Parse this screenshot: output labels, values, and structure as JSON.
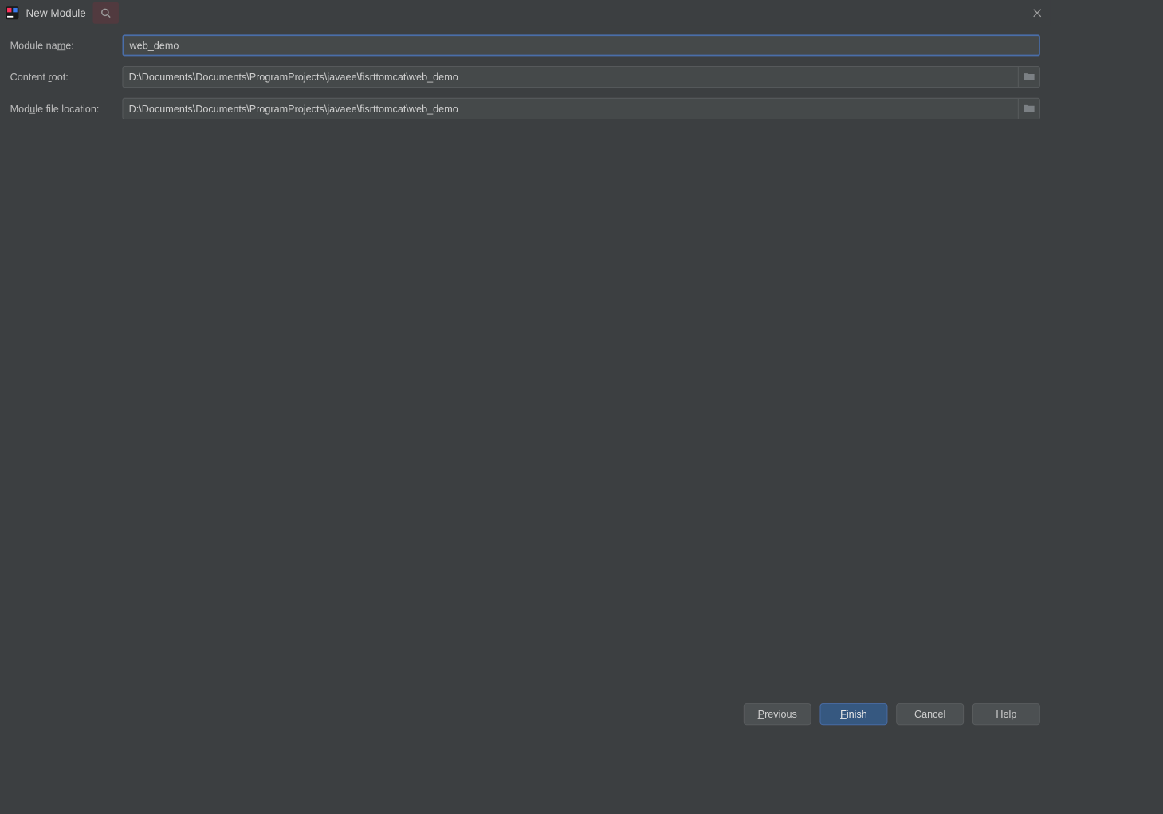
{
  "window": {
    "title": "New Module"
  },
  "form": {
    "module_name": {
      "label_pre": "Module na",
      "label_mnemonic": "m",
      "label_post": "e:",
      "value": "web_demo"
    },
    "content_root": {
      "label_pre": "Content ",
      "label_mnemonic": "r",
      "label_post": "oot:",
      "value": "D:\\Documents\\Documents\\ProgramProjects\\javaee\\fisrttomcat\\web_demo"
    },
    "module_file_location": {
      "label_pre": "Mod",
      "label_mnemonic": "u",
      "label_post": "le file location:",
      "value": "D:\\Documents\\Documents\\ProgramProjects\\javaee\\fisrttomcat\\web_demo"
    }
  },
  "buttons": {
    "previous_mnemonic": "P",
    "previous_post": "revious",
    "finish_mnemonic": "F",
    "finish_post": "inish",
    "cancel": "Cancel",
    "help": "Help"
  }
}
